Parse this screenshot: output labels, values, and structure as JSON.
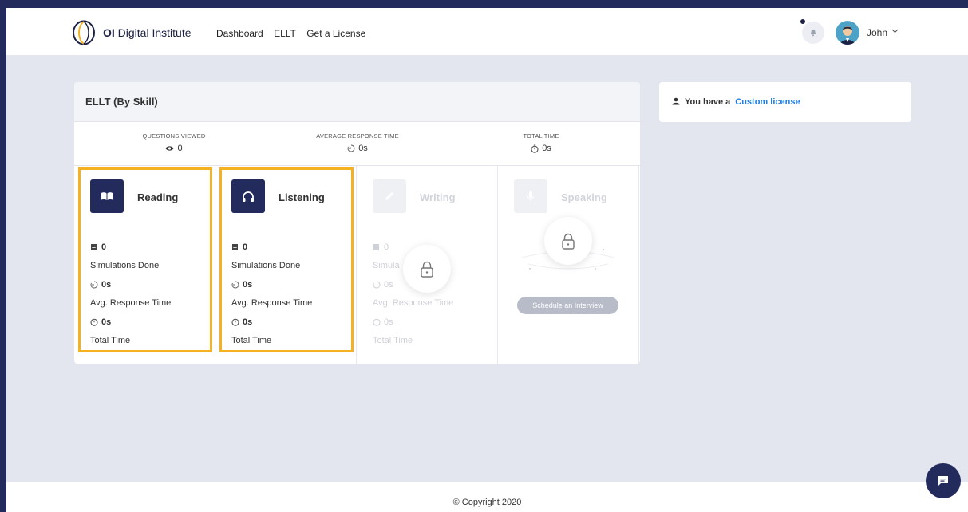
{
  "header": {
    "brand_bold": "OI",
    "brand_rest": "Digital Institute",
    "nav": [
      "Dashboard",
      "ELLT",
      "Get a License"
    ],
    "username": "John"
  },
  "card": {
    "title": "ELLT (By Skill)",
    "stats": [
      {
        "label": "QUESTIONS VIEWED",
        "value": "0",
        "icon": "eye-icon"
      },
      {
        "label": "AVERAGE RESPONSE TIME",
        "value": "0s",
        "icon": "response-time-icon"
      },
      {
        "label": "TOTAL TIME",
        "value": "0s",
        "icon": "stopwatch-icon"
      }
    ],
    "skills": [
      {
        "name": "Reading",
        "icon": "book-icon",
        "locked": false,
        "simulations": "0",
        "simulations_label": "Simulations Done",
        "avg": "0s",
        "avg_label": "Avg. Response Time",
        "total": "0s",
        "total_label": "Total Time"
      },
      {
        "name": "Listening",
        "icon": "headphones-icon",
        "locked": false,
        "simulations": "0",
        "simulations_label": "Simulations Done",
        "avg": "0s",
        "avg_label": "Avg. Response Time",
        "total": "0s",
        "total_label": "Total Time"
      },
      {
        "name": "Writing",
        "icon": "pencil-icon",
        "locked": true,
        "simulations": "0",
        "simulations_label": "Simula",
        "avg": "0s",
        "avg_label": "Avg. Response Time",
        "total": "0s",
        "total_label": "Total Time"
      },
      {
        "name": "Speaking",
        "icon": "microphone-icon",
        "locked": true,
        "button": "Schedule an Interview"
      }
    ]
  },
  "license": {
    "prefix": "You have a",
    "link": "Custom license"
  },
  "footer": {
    "copyright": "© Copyright 2020"
  },
  "colors": {
    "navy": "#232a5c",
    "accent_link": "#1d7de0",
    "highlight": "#f4b223"
  }
}
